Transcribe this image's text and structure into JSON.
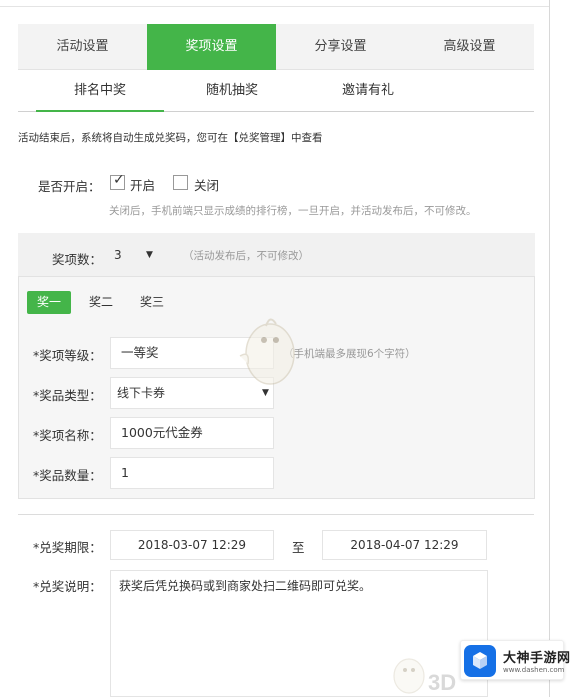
{
  "tabs": {
    "main": [
      "活动设置",
      "奖项设置",
      "分享设置",
      "高级设置"
    ],
    "active_main_index": 1,
    "sub": [
      "排名中奖",
      "随机抽奖",
      "邀请有礼"
    ],
    "active_sub_index": 0
  },
  "notice": "活动结束后，系统将自动生成兑奖码，您可在【兑奖管理】中查看",
  "enable": {
    "label": "是否开启：",
    "on_label": "开启",
    "on_checked": true,
    "off_label": "关闭",
    "off_checked": false,
    "hint": "关闭后，手机前端只显示成绩的排行榜，一旦开启，并活动发布后，不可修改。"
  },
  "prize_count": {
    "label": "奖项数：",
    "value": "3",
    "hint": "（活动发布后，不可修改）"
  },
  "prize_tabs": [
    "奖一",
    "奖二",
    "奖三"
  ],
  "active_prize_index": 0,
  "prize_form": {
    "level_label": "*奖项等级：",
    "level_value": "一等奖",
    "level_hint": "（手机端最多展现6个字符）",
    "type_label": "*奖品类型：",
    "type_value": "线下卡券",
    "name_label": "*奖项名称：",
    "name_value": "1000元代金券",
    "qty_label": "*奖品数量：",
    "qty_value": "1"
  },
  "redeem": {
    "period_label": "*兑奖期限：",
    "start": "2018-03-07 12:29",
    "to": "至",
    "end": "2018-04-07 12:29",
    "desc_label": "*兑奖说明：",
    "desc_value": "获奖后凭兑换码或到商家处扫二维码即可兑奖。"
  },
  "watermark": {
    "text": "3D",
    "brand_name": "大神手游网",
    "brand_site": "www.dashen.com"
  },
  "colors": {
    "accent": "#44b549",
    "brand_blue": "#1570e6"
  }
}
